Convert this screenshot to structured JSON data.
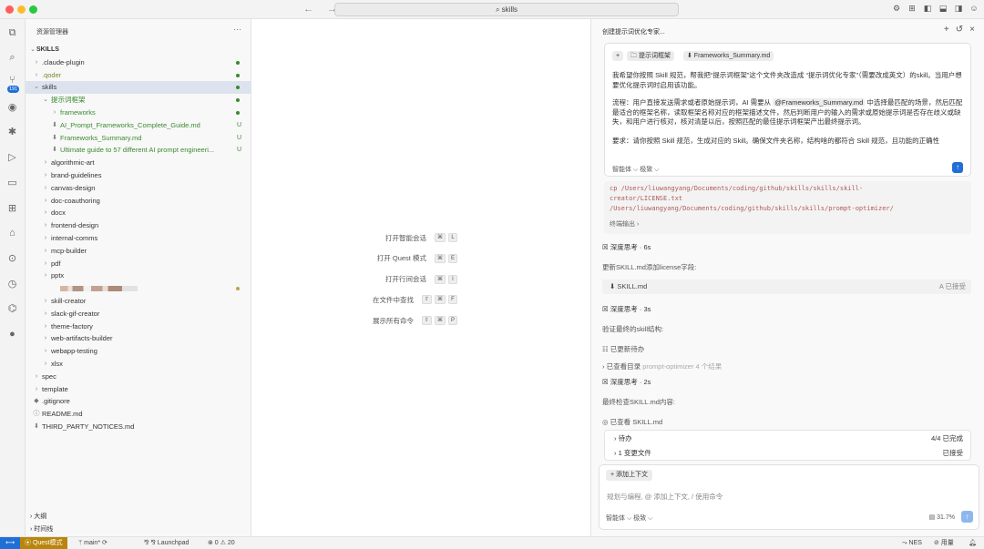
{
  "titlebar": {
    "search_text": "⌕ skills",
    "nav": "← →"
  },
  "explorer": {
    "header": "资源管理器",
    "root": "SKILLS",
    "rows": [
      {
        "label": ".claude-plugin",
        "depth": 1,
        "chev": "›",
        "dot": "#3a8a2e"
      },
      {
        "label": ".qoder",
        "depth": 1,
        "chev": "›",
        "dot": "#3a8a2e",
        "color": "olive"
      },
      {
        "label": "skills",
        "depth": 1,
        "chev": "⌄",
        "dot": "#3a8a2e",
        "selected": true
      },
      {
        "label": "提示词框架",
        "depth": 2,
        "chev": "⌄",
        "dot": "#3a8a2e",
        "color": "green"
      },
      {
        "label": "frameworks",
        "depth": 3,
        "chev": "›",
        "dot": "#3a8a2e",
        "color": "green"
      },
      {
        "label": "AI_Prompt_Frameworks_Complete_Guide.md",
        "depth": 3,
        "icon": "⬇",
        "status": "U",
        "color": "green"
      },
      {
        "label": "Frameworks_Summary.md",
        "depth": 3,
        "icon": "⬇",
        "status": "U",
        "color": "green"
      },
      {
        "label": "Ultimate guide to 57 different AI prompt engineeri...",
        "depth": 3,
        "icon": "⬇",
        "status": "U",
        "color": "green"
      },
      {
        "label": "algorithmic-art",
        "depth": 2,
        "chev": "›"
      },
      {
        "label": "brand-guidelines",
        "depth": 2,
        "chev": "›"
      },
      {
        "label": "canvas-design",
        "depth": 2,
        "chev": "›"
      },
      {
        "label": "doc-coauthoring",
        "depth": 2,
        "chev": "›"
      },
      {
        "label": "docx",
        "depth": 2,
        "chev": "›"
      },
      {
        "label": "frontend-design",
        "depth": 2,
        "chev": "›"
      },
      {
        "label": "internal-comms",
        "depth": 2,
        "chev": "›"
      },
      {
        "label": "mcp-builder",
        "depth": 2,
        "chev": "›"
      },
      {
        "label": "pdf",
        "depth": 2,
        "chev": "›"
      },
      {
        "label": "pptx",
        "depth": 2,
        "chev": "›"
      },
      {
        "label": "",
        "depth": 2,
        "blurred": true,
        "dot": "#b8a45a"
      },
      {
        "label": "skill-creator",
        "depth": 2,
        "chev": "›"
      },
      {
        "label": "slack-gif-creator",
        "depth": 2,
        "chev": "›"
      },
      {
        "label": "theme-factory",
        "depth": 2,
        "chev": "›"
      },
      {
        "label": "web-artifacts-builder",
        "depth": 2,
        "chev": "›"
      },
      {
        "label": "webapp-testing",
        "depth": 2,
        "chev": "›"
      },
      {
        "label": "xlsx",
        "depth": 2,
        "chev": "›"
      },
      {
        "label": "spec",
        "depth": 1,
        "chev": "›"
      },
      {
        "label": "template",
        "depth": 1,
        "chev": "›"
      },
      {
        "label": ".gitignore",
        "depth": 1,
        "icon": "◆"
      },
      {
        "label": "README.md",
        "depth": 1,
        "icon": "ⓘ"
      },
      {
        "label": "THIRD_PARTY_NOTICES.md",
        "depth": 1,
        "icon": "⬇"
      }
    ],
    "outline": "大纲",
    "timeline": "时间线"
  },
  "editor": {
    "shortcuts": [
      {
        "label": "打开智能会话",
        "keys": [
          "⌘",
          "L"
        ]
      },
      {
        "label": "打开 Quest 模式",
        "keys": [
          "⌘",
          "E"
        ]
      },
      {
        "label": "打开行间会话",
        "keys": [
          "⌘",
          "I"
        ]
      },
      {
        "label": "在文件中查找",
        "keys": [
          "⇧",
          "⌘",
          "F"
        ]
      },
      {
        "label": "展示所有命令",
        "keys": [
          "⇧",
          "⌘",
          "P"
        ]
      }
    ]
  },
  "agent": {
    "title": "创建提示词优化专家...",
    "chips": [
      "+",
      "🗀 提示词框架",
      "⬇ Frameworks_Summary.md"
    ],
    "message": {
      "p1": "我希望你按照 Skill 规范，帮我把“提示词框架”这个文件夹改造成 “提示词优化专家”（需要改成英文）的skill。当用户想要优化提示词时启用该功能。",
      "p2_a": "流程：用户直接发送需求或者原始提示词，AI 需要从 ",
      "p2_mention": "@Frameworks_Summary.md",
      "p2_b": " 中选择最匹配的场景，然后匹配最适合的框架名称，读取框架名称对应的框架描述文件，然后判断用户的输入的需求或原始提示词是否存在歧义或缺失，和用户进行核对，核对清楚以后，按照匹配的最佳提示词框架产出最终提示词。",
      "p3": "要求：请你按照 Skill 规范，生成对应的 Skill。确保文件夹名称，结构啥的都符合 Skill 规范，且功能的正确性",
      "footer": "智能体 ⌵   极致 ⌵"
    },
    "code": "cp /Users/liuwangyang/Documents/coding/github/skills/skills/skill-\ncreator/LICENSE.txt\n/Users/liuwangyang/Documents/coding/github/skills/skills/prompt-optimizer/",
    "code_footer": "终端输出 ›",
    "steps": {
      "think1": "☒ 深度思考 · 6s",
      "text1": "更新SKILL.md添加license字段:",
      "file1": "⬇ SKILL.md",
      "file1_status": "A  已接受",
      "think2": "☒ 深度思考 · 3s",
      "text2": "验证最终的skill结构:",
      "todo": "☷ 已更新待办",
      "viewed_dir": "› 已查看目录",
      "viewed_dir_detail": "prompt-optimizer 4 个结果",
      "think3": "☒ 深度思考 · 2s",
      "text3": "最终检查SKILL.md内容:",
      "viewed_file": "◎ 已查看 SKILL.md"
    },
    "summary": [
      {
        "label": "› 待办",
        "right": "4/4 已完成"
      },
      {
        "label": "› 1 变更文件",
        "right": "已接受"
      }
    ],
    "input": {
      "context_chip": "+ 添加上下文",
      "placeholder": "规划与编程, @ 添加上下文, / 使用命令",
      "footer": "智能体 ⌵   极致 ⌵",
      "usage": "▤ 31.7%"
    }
  },
  "statusbar": {
    "mode": "⦿ Quest模式",
    "branch": "ᛘ main* ⟳",
    "launchpad": "⅋ ⅋ Launchpad",
    "problems": "⊗ 0 ⚠ 20",
    "right_nes": "⤳ NES",
    "right_usage": "⊘ 用量"
  }
}
